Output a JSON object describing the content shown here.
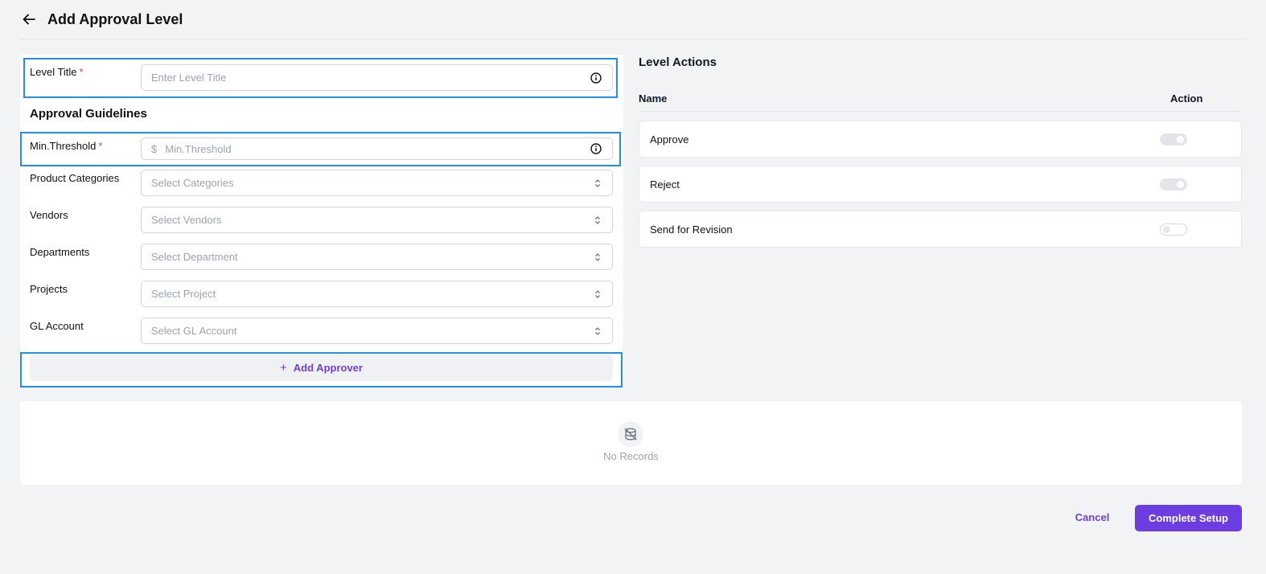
{
  "header": {
    "title": "Add Approval Level",
    "back_icon": "arrow-left-icon"
  },
  "form": {
    "level_title": {
      "label": "Level Title",
      "required_mark": "*",
      "placeholder": "Enter Level Title"
    },
    "guidelines_title": "Approval Guidelines",
    "min_threshold": {
      "label": "Min.Threshold",
      "required_mark": "*",
      "prefix": "$",
      "placeholder": "Min.Threshold"
    },
    "product_categories": {
      "label": "Product Categories",
      "placeholder": "Select Categories"
    },
    "vendors": {
      "label": "Vendors",
      "placeholder": "Select Vendors"
    },
    "departments": {
      "label": "Departments",
      "placeholder": "Select Department"
    },
    "projects": {
      "label": "Projects",
      "placeholder": "Select Project"
    },
    "gl_account": {
      "label": "GL Account",
      "placeholder": "Select GL Account"
    },
    "add_approver": {
      "icon": "+",
      "label": "Add Approver"
    }
  },
  "level_actions": {
    "title": "Level Actions",
    "columns": {
      "name": "Name",
      "action": "Action"
    },
    "rows": [
      {
        "name": "Approve",
        "enabled": true
      },
      {
        "name": "Reject",
        "enabled": true
      },
      {
        "name": "Send for Revision",
        "enabled": false
      }
    ]
  },
  "records": {
    "empty_text": "No Records",
    "icon": "no-records-icon"
  },
  "footer": {
    "cancel_label": "Cancel",
    "complete_label": "Complete Setup"
  },
  "colors": {
    "accent": "#6c3de0",
    "highlight": "#1e90e8",
    "required": "#ef4444",
    "background": "#f2f3f5"
  }
}
